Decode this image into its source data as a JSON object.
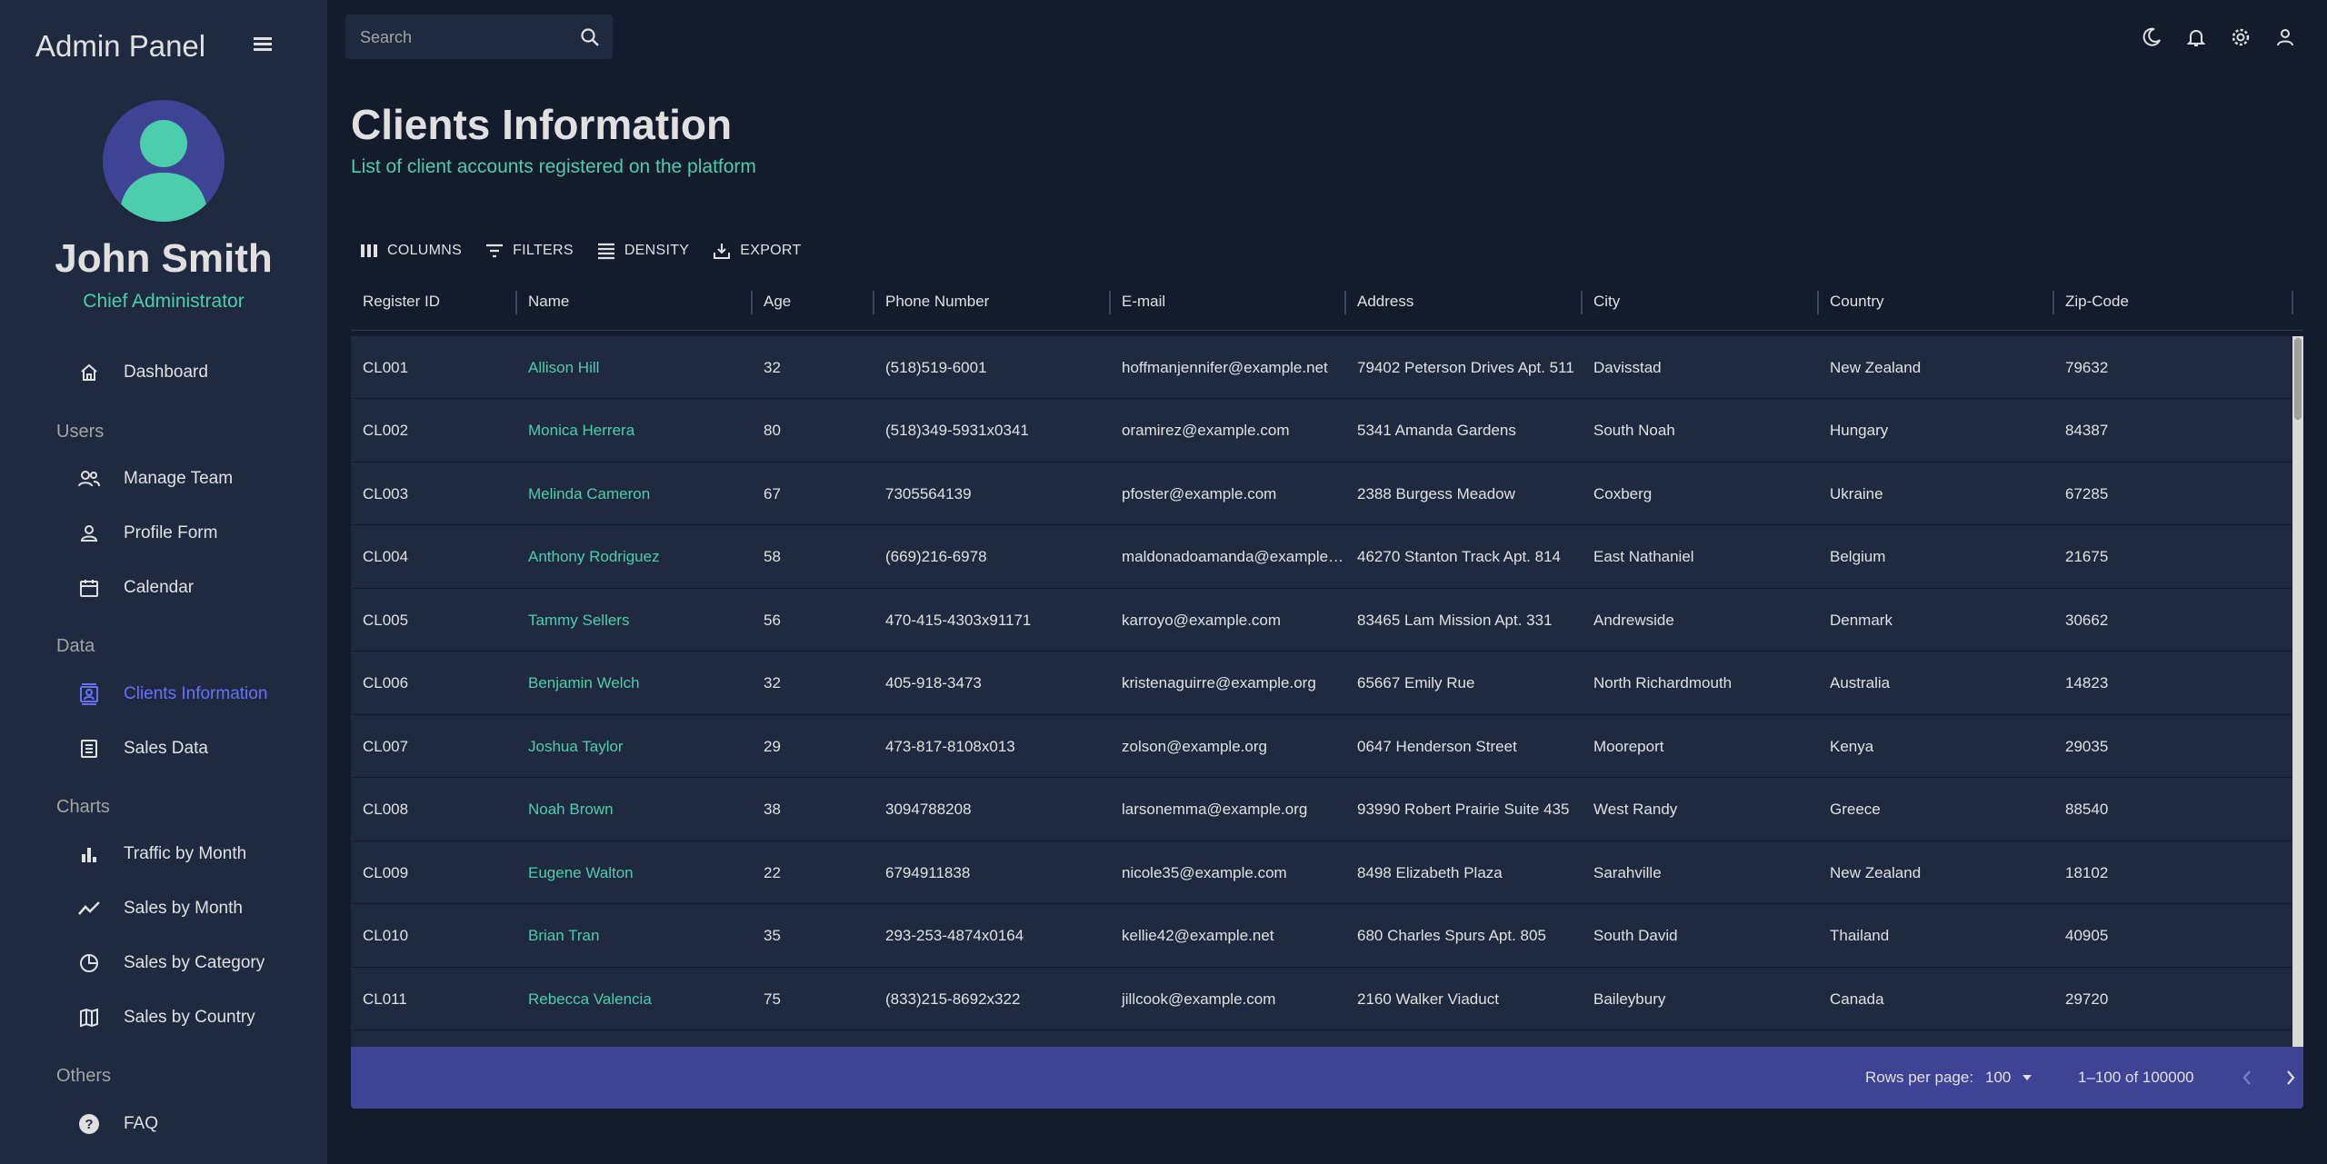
{
  "app": {
    "brand": "Admin Panel"
  },
  "user": {
    "name": "John Smith",
    "role": "Chief Administrator"
  },
  "search": {
    "placeholder": "Search"
  },
  "sidebar": {
    "dashboard": "Dashboard",
    "sections": [
      "Users",
      "Data",
      "Charts",
      "Others"
    ],
    "users_items": [
      "Manage Team",
      "Profile Form",
      "Calendar"
    ],
    "data_items": [
      "Clients Information",
      "Sales Data"
    ],
    "charts_items": [
      "Traffic by Month",
      "Sales by Month",
      "Sales by Category",
      "Sales by Country"
    ],
    "others_items": [
      "FAQ"
    ],
    "active": "Clients Information",
    "active_color": "#6870fa"
  },
  "header": {
    "title": "Clients Information",
    "subtitle": "List of client accounts registered on the platform"
  },
  "toolbar": {
    "columns": "COLUMNS",
    "filters": "FILTERS",
    "density": "DENSITY",
    "export": "EXPORT"
  },
  "table": {
    "columns": [
      "Register ID",
      "Name",
      "Age",
      "Phone Number",
      "E-mail",
      "Address",
      "City",
      "Country",
      "Zip-Code"
    ],
    "rows": [
      [
        "CL001",
        "Allison Hill",
        "32",
        "(518)519-6001",
        "hoffmanjennifer@example.net",
        "79402 Peterson Drives Apt. 511",
        "Davisstad",
        "New Zealand",
        "79632"
      ],
      [
        "CL002",
        "Monica Herrera",
        "80",
        "(518)349-5931x0341",
        "oramirez@example.com",
        "5341 Amanda Gardens",
        "South Noah",
        "Hungary",
        "84387"
      ],
      [
        "CL003",
        "Melinda Cameron",
        "67",
        "7305564139",
        "pfoster@example.com",
        "2388 Burgess Meadow",
        "Coxberg",
        "Ukraine",
        "67285"
      ],
      [
        "CL004",
        "Anthony Rodriguez",
        "58",
        "(669)216-6978",
        "maldonadoamanda@example…",
        "46270 Stanton Track Apt. 814",
        "East Nathaniel",
        "Belgium",
        "21675"
      ],
      [
        "CL005",
        "Tammy Sellers",
        "56",
        "470-415-4303x91171",
        "karroyo@example.com",
        "83465 Lam Mission Apt. 331",
        "Andrewside",
        "Denmark",
        "30662"
      ],
      [
        "CL006",
        "Benjamin Welch",
        "32",
        "405-918-3473",
        "kristenaguirre@example.org",
        "65667 Emily Rue",
        "North Richardmouth",
        "Australia",
        "14823"
      ],
      [
        "CL007",
        "Joshua Taylor",
        "29",
        "473-817-8108x013",
        "zolson@example.org",
        "0647 Henderson Street",
        "Mooreport",
        "Kenya",
        "29035"
      ],
      [
        "CL008",
        "Noah Brown",
        "38",
        "3094788208",
        "larsonemma@example.org",
        "93990 Robert Prairie Suite 435",
        "West Randy",
        "Greece",
        "88540"
      ],
      [
        "CL009",
        "Eugene Walton",
        "22",
        "6794911838",
        "nicole35@example.com",
        "8498 Elizabeth Plaza",
        "Sarahville",
        "New Zealand",
        "18102"
      ],
      [
        "CL010",
        "Brian Tran",
        "35",
        "293-253-4874x0164",
        "kellie42@example.net",
        "680 Charles Spurs Apt. 805",
        "South David",
        "Thailand",
        "40905"
      ],
      [
        "CL011",
        "Rebecca Valencia",
        "75",
        "(833)215-8692x322",
        "jillcook@example.com",
        "2160 Walker Viaduct",
        "Baileybury",
        "Canada",
        "29720"
      ]
    ]
  },
  "pagination": {
    "rows_label": "Rows per page:",
    "rows_value": "100",
    "range": "1–100 of 100000"
  },
  "colors": {
    "accent": "#4cceac",
    "primary": "#3e4396",
    "background": "#141b2d",
    "panel": "#1f2a40"
  }
}
